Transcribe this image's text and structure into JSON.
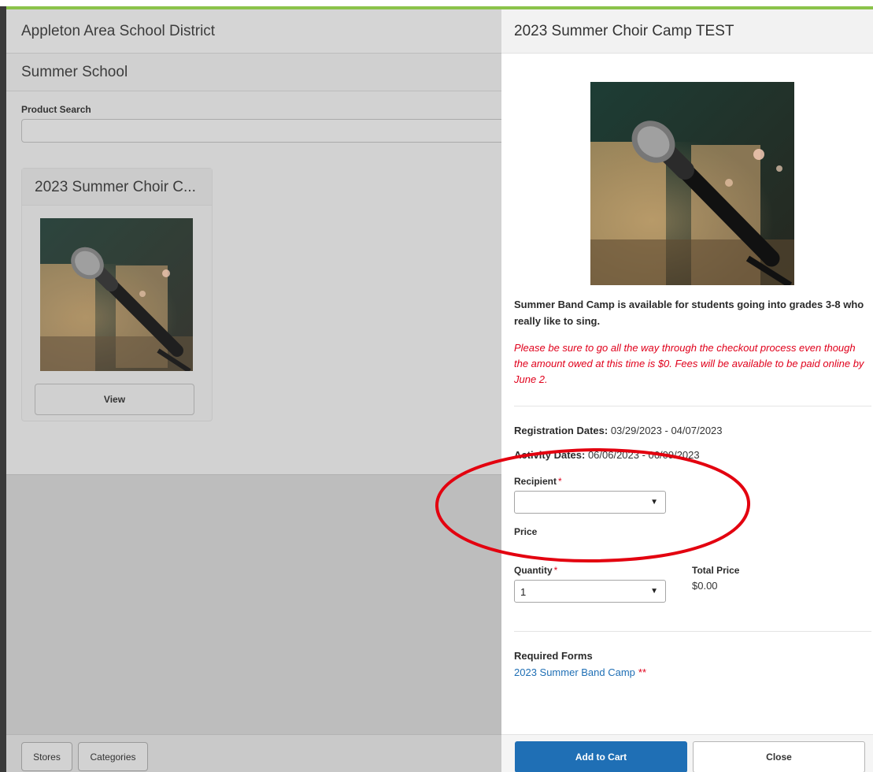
{
  "store": {
    "district_name": "Appleton Area School District",
    "store_name": "Summer School",
    "search": {
      "label": "Product Search",
      "value": ""
    },
    "product_card": {
      "title": "2023 Summer Choir C...",
      "image_icon": "microphone-photo",
      "view_label": "View"
    },
    "footer": {
      "stores_label": "Stores",
      "categories_label": "Categories"
    }
  },
  "detail": {
    "title": "2023 Summer Choir Camp TEST",
    "image_icon": "microphone-photo",
    "description": "Summer Band Camp is available for students going into grades 3-8 who really like to sing.",
    "note": "Please be sure to go all the way through the checkout process even though the amount owed at this time is $0. Fees will be available to be paid online by June 2.",
    "registration": {
      "label": "Registration Dates:",
      "value": "03/29/2023 - 04/07/2023"
    },
    "activity": {
      "label": "Activity Dates:",
      "value": "06/06/2023 - 06/09/2023"
    },
    "recipient": {
      "label": "Recipient",
      "required": "*",
      "value": ""
    },
    "price": {
      "label": "Price"
    },
    "quantity": {
      "label": "Quantity",
      "required": "*",
      "value": "1"
    },
    "total": {
      "label": "Total Price",
      "value": "$0.00"
    },
    "required_forms": {
      "label": "Required Forms",
      "link": "2023 Summer Band Camp",
      "marker": "**"
    },
    "add_to_cart_label": "Add to Cart",
    "close_label": "Close"
  },
  "colors": {
    "accent": "#8bc34a",
    "primary": "#1f6fb5",
    "required": "#e0001b",
    "annotation": "#e3000f"
  }
}
